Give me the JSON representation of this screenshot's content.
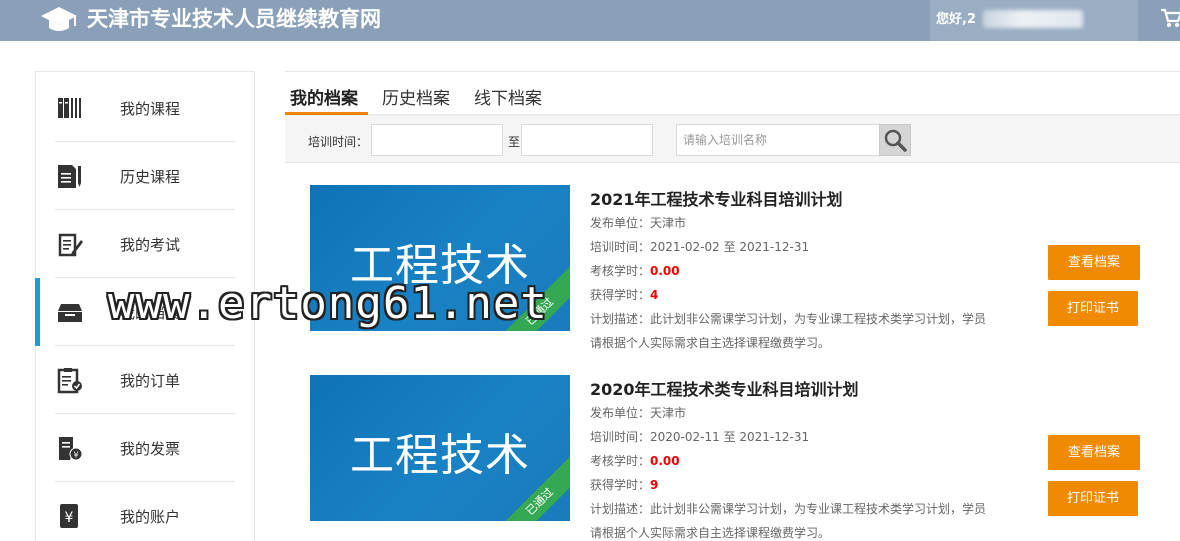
{
  "header": {
    "site_title": "天津市专业技术人员继续教育网",
    "greeting": "您好,2"
  },
  "sidebar": {
    "items": [
      {
        "label": "我的课程",
        "icon": "books-icon"
      },
      {
        "label": "历史课程",
        "icon": "document-pen-icon"
      },
      {
        "label": "我的考试",
        "icon": "exam-icon"
      },
      {
        "label": "我的档案",
        "icon": "archive-box-icon",
        "active": true
      },
      {
        "label": "我的订单",
        "icon": "clipboard-check-icon"
      },
      {
        "label": "我的发票",
        "icon": "invoice-icon"
      },
      {
        "label": "我的账户",
        "icon": "yen-account-icon"
      }
    ]
  },
  "tabs": [
    {
      "label": "我的档案",
      "active": true
    },
    {
      "label": "历史档案"
    },
    {
      "label": "线下档案"
    }
  ],
  "filter": {
    "time_label": "培训时间：",
    "to_label": "至",
    "search_placeholder": "请输入培训名称"
  },
  "records": [
    {
      "thumb_text": "工程技术",
      "badge": "已通过",
      "title": "2021年工程技术专业科目培训计划",
      "publisher_label": "发布单位：",
      "publisher": "天津市",
      "time_label": "培训时间：",
      "time": "2021-02-02 至 2021-12-31",
      "assess_label": "考核学时：",
      "assess_hours": "0.00",
      "earned_label": "获得学时：",
      "earned_hours": "4",
      "desc_line1": "计划描述：此计划非公需课学习计划，为专业课工程技术类学习计划，学员",
      "desc_line2": "请根据个人实际需求自主选择课程缴费学习。",
      "view_btn": "查看档案",
      "print_btn": "打印证书"
    },
    {
      "thumb_text": "工程技术",
      "badge": "已通过",
      "title": "2020年工程技术类专业科目培训计划",
      "publisher_label": "发布单位：",
      "publisher": "天津市",
      "time_label": "培训时间：",
      "time": "2020-02-11 至 2021-12-31",
      "assess_label": "考核学时：",
      "assess_hours": "0.00",
      "earned_label": "获得学时：",
      "earned_hours": "9",
      "desc_line1": "计划描述：此计划非公需课学习计划，为专业课工程技术类学习计划，学员",
      "desc_line2": "请根据个人实际需求自主选择课程缴费学习。",
      "view_btn": "查看档案",
      "print_btn": "打印证书"
    }
  ],
  "watermark": "www.ertong61.net",
  "colors": {
    "header_bg": "#8aa0b9",
    "active_accent": "#1c9bd6",
    "tab_underline": "#f08300",
    "button_orange": "#f08a00",
    "badge_green": "#34a853",
    "value_red": "#e00000"
  }
}
